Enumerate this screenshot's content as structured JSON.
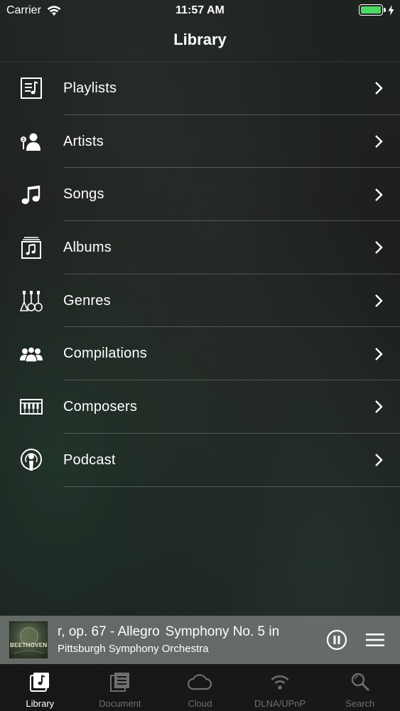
{
  "status_bar": {
    "carrier": "Carrier",
    "time": "11:57 AM",
    "battery_level": 1.0,
    "battery_color": "#4cd964",
    "charging": true
  },
  "nav": {
    "title": "Library"
  },
  "library_items": [
    {
      "label": "Playlists",
      "icon": "playlist-icon"
    },
    {
      "label": "Artists",
      "icon": "artist-icon"
    },
    {
      "label": "Songs",
      "icon": "music-note-icon"
    },
    {
      "label": "Albums",
      "icon": "album-icon"
    },
    {
      "label": "Genres",
      "icon": "genres-icon"
    },
    {
      "label": "Compilations",
      "icon": "compilations-icon"
    },
    {
      "label": "Composers",
      "icon": "piano-icon"
    },
    {
      "label": "Podcast",
      "icon": "podcast-icon"
    }
  ],
  "now_playing": {
    "title": "r, op. 67 - Allegro",
    "title_continuation": "Symphony No. 5 in",
    "artist": "Pittsburgh Symphony Orchestra",
    "artwork_text": "BEETHOVEN"
  },
  "tabs": [
    {
      "label": "Library",
      "icon": "library-icon",
      "active": true
    },
    {
      "label": "Document",
      "icon": "document-icon",
      "active": false
    },
    {
      "label": "Cloud",
      "icon": "cloud-icon",
      "active": false
    },
    {
      "label": "DLNA/UPnP",
      "icon": "wifi-icon",
      "active": false
    },
    {
      "label": "Search",
      "icon": "search-icon",
      "active": false
    }
  ],
  "colors": {
    "active_tab": "#ffffff",
    "inactive_tab": "#6d6f6e",
    "separator": "rgba(255,255,255,0.22)"
  }
}
